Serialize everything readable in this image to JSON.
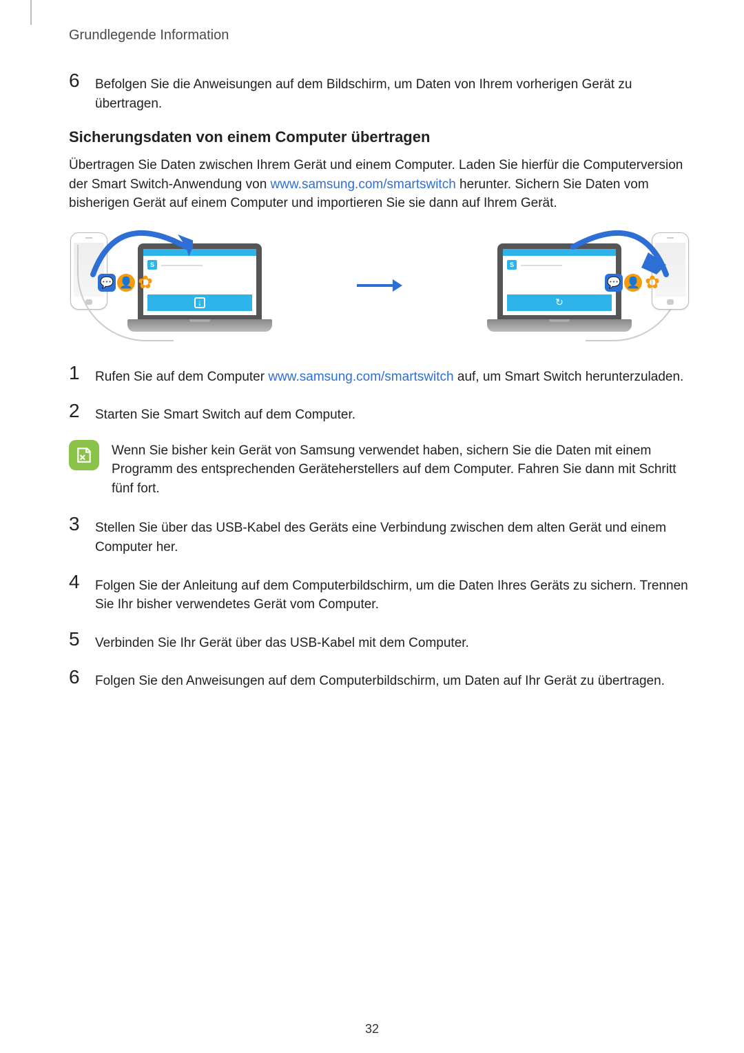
{
  "header": {
    "title": "Grundlegende Information"
  },
  "top_step": {
    "num": "6",
    "text": "Befolgen Sie die Anweisungen auf dem Bildschirm, um Daten von Ihrem vorherigen Gerät zu übertragen."
  },
  "section": {
    "heading": "Sicherungsdaten von einem Computer übertragen"
  },
  "intro": {
    "pre": "Übertragen Sie Daten zwischen Ihrem Gerät und einem Computer. Laden Sie hierfür die Computerversion der Smart Switch-Anwendung von ",
    "link": "www.samsung.com/smartswitch",
    "post": " herunter. Sichern Sie Daten vom bisherigen Gerät auf einem Computer und importieren Sie sie dann auf Ihrem Gerät."
  },
  "steps": {
    "s1": {
      "num": "1",
      "pre": "Rufen Sie auf dem Computer ",
      "link": "www.samsung.com/smartswitch",
      "post": " auf, um Smart Switch herunterzuladen."
    },
    "s2": {
      "num": "2",
      "text": "Starten Sie Smart Switch auf dem Computer."
    },
    "note": "Wenn Sie bisher kein Gerät von Samsung verwendet haben, sichern Sie die Daten mit einem Programm des entsprechenden Geräteherstellers auf dem Computer. Fahren Sie dann mit Schritt fünf fort.",
    "s3": {
      "num": "3",
      "text": "Stellen Sie über das USB-Kabel des Geräts eine Verbindung zwischen dem alten Gerät und einem Computer her."
    },
    "s4": {
      "num": "4",
      "text": "Folgen Sie der Anleitung auf dem Computerbildschirm, um die Daten Ihres Geräts zu sichern. Trennen Sie Ihr bisher verwendetes Gerät vom Computer."
    },
    "s5": {
      "num": "5",
      "text": "Verbinden Sie Ihr Gerät über das USB-Kabel mit dem Computer."
    },
    "s6": {
      "num": "6",
      "text": "Folgen Sie den Anweisungen auf dem Computerbildschirm, um Daten auf Ihr Gerät zu übertragen."
    }
  },
  "page_number": "32",
  "figure": {
    "app_letter": "S"
  },
  "colors": {
    "link": "#2e6fd6",
    "accent": "#2fb4e9",
    "note_icon": "#8bc34a",
    "orange": "#f39c12"
  }
}
